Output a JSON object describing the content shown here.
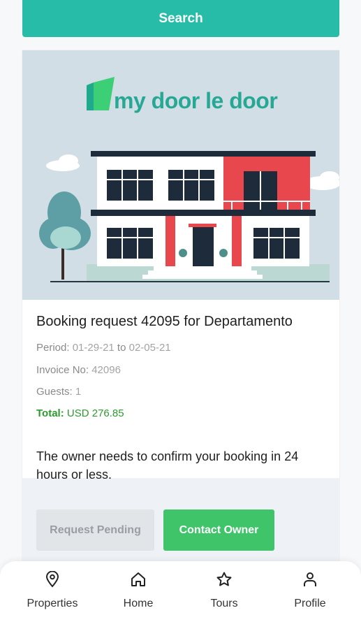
{
  "search": {
    "label": "Search"
  },
  "brand": {
    "logo_text": "my door le door"
  },
  "booking": {
    "title": "Booking request 42095 for Departamento",
    "period_label": "Period:",
    "period_from": "01-29-21",
    "period_to_word": "to",
    "period_to": "02-05-21",
    "invoice_label": "Invoice No:",
    "invoice_value": "42096",
    "guests_label": "Guests:",
    "guests_value": "1",
    "total_label": "Total:",
    "total_value": "USD 276.85",
    "notice": "The owner needs to confirm your booking in 24 hours or less.",
    "pending_button": "Request Pending",
    "contact_button": "Contact Owner"
  },
  "colors": {
    "accent": "#26bca7",
    "success": "#3fc46a",
    "total_text": "#2e9a2e",
    "house_red": "#e8474d",
    "navy": "#1d2b3a"
  },
  "tabbar": {
    "items": [
      {
        "label": "Properties",
        "icon": "map-pin-icon"
      },
      {
        "label": "Home",
        "icon": "home-icon"
      },
      {
        "label": "Tours",
        "icon": "star-icon"
      },
      {
        "label": "Profile",
        "icon": "user-icon"
      }
    ]
  }
}
